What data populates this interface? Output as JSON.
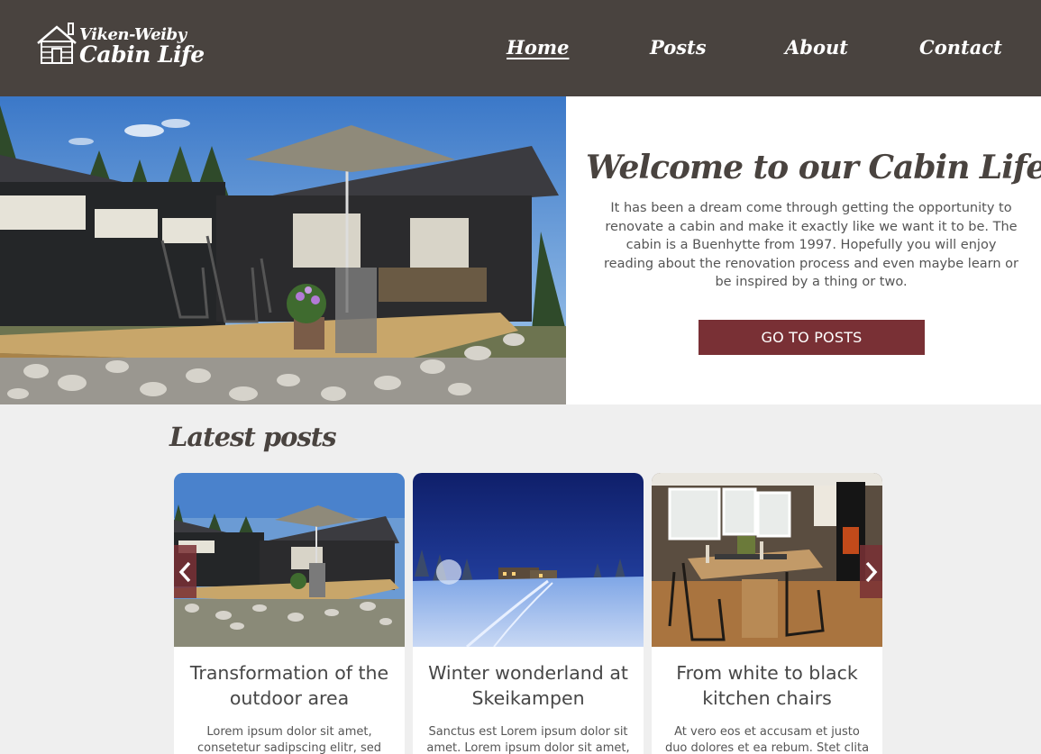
{
  "brand": {
    "line1": "Viken-Weiby",
    "line2": "Cabin Life"
  },
  "nav": [
    {
      "label": "Home",
      "active": true
    },
    {
      "label": "Posts",
      "active": false
    },
    {
      "label": "About",
      "active": false
    },
    {
      "label": "Contact",
      "active": false
    }
  ],
  "hero": {
    "title": "Welcome to our Cabin Life",
    "text": "It has been a dream come through getting the opportunity to renovate a cabin and make it exactly like we want it to be. The cabin is a Buenhytte from 1997. Hopefully you will enjoy reading about the renovation process and even maybe learn or be inspired by a thing or two.",
    "button": "GO TO POSTS"
  },
  "latest": {
    "title": "Latest posts",
    "posts": [
      {
        "title": "Transformation of the outdoor area",
        "excerpt": "Lorem ipsum dolor sit amet, consetetur sadipscing elitr, sed"
      },
      {
        "title": "Winter wonderland at Skeikampen",
        "excerpt": "Sanctus est Lorem ipsum dolor sit amet. Lorem ipsum dolor sit amet,"
      },
      {
        "title": "From white to black kitchen chairs",
        "excerpt": "At vero eos et accusam et justo duo dolores et ea rebum. Stet clita kasd"
      }
    ]
  },
  "colors": {
    "header": "#49433f",
    "accent": "#793035",
    "background": "#efefef"
  }
}
